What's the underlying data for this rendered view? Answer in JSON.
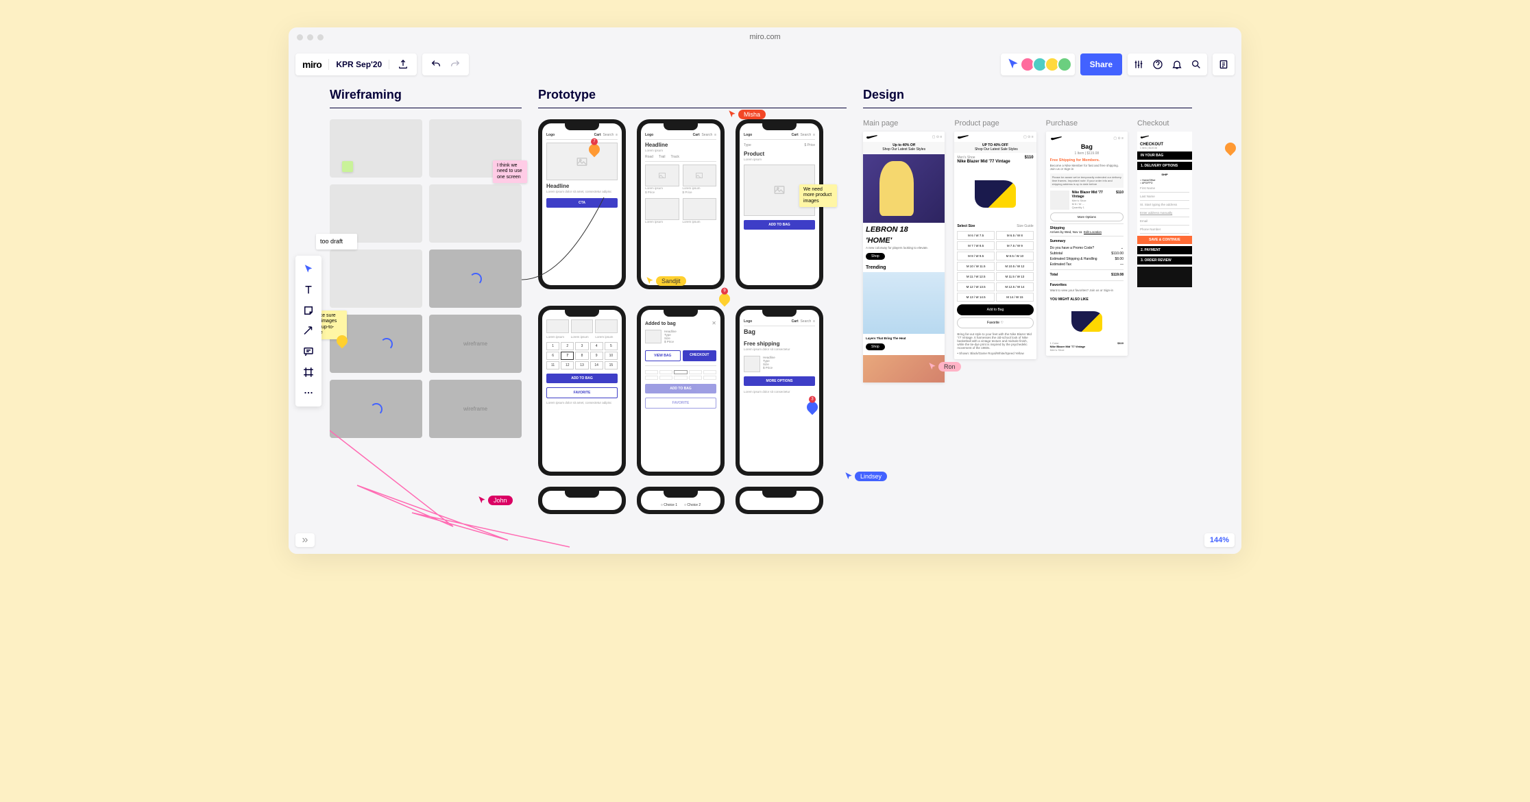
{
  "browser": {
    "url": "miro.com"
  },
  "header": {
    "logo": "miro",
    "board_name": "KPR Sep'20",
    "share_label": "Share"
  },
  "toolbar": [
    "select",
    "text",
    "sticky",
    "shape",
    "connect",
    "comment",
    "frame",
    "more"
  ],
  "sections": {
    "wireframing": {
      "title": "Wireframing"
    },
    "prototype": {
      "title": "Prototype"
    },
    "design": {
      "title": "Design",
      "columns": [
        "Main page",
        "Product page",
        "Purchase",
        "Checkout"
      ]
    }
  },
  "cursors": {
    "misha": "Misha",
    "sandjit": "Sandjit",
    "john": "John",
    "lindsey": "Lindsey",
    "ron": "Ron"
  },
  "stickies": {
    "too_draft": "too draft",
    "pink": "I think we need to use one screen",
    "need_images": "We need more product images",
    "uptodate": "Make sure the images are up-to-date"
  },
  "wireframes": {
    "placeholder_label": "wireframe"
  },
  "phones": {
    "row1": {
      "p1": {
        "logo": "Logo",
        "cart": "Cart",
        "search": "Search",
        "headline": "Headline",
        "lorem": "Lorem ipsum dolor sit amet, consectetur adipisc",
        "cta": "CTA",
        "badge": "7"
      },
      "p2": {
        "logo": "Logo",
        "cart": "Cart",
        "search": "Search",
        "headline": "Headline",
        "lorem": "Lorem ipsum",
        "tabs": [
          "Road",
          "Trail",
          "Track"
        ],
        "item_lorem": "Lorem ipsum",
        "item_price": "$ Price"
      },
      "p3": {
        "logo": "Logo",
        "cart": "Cart",
        "search": "Search",
        "type": "Type",
        "price": "$ Price",
        "product": "Product",
        "lorem": "Lorem ipsum",
        "add": "ADD TO BAG"
      }
    },
    "row2": {
      "p1": {
        "lorem": "Lorem ipsum",
        "add": "ADD TO BAG",
        "fav": "FAVORITE",
        "thumbs": 3,
        "sizes": 15
      },
      "p2": {
        "title": "Added to bag",
        "headline": "Headline",
        "type": "Type",
        "size": "Size",
        "price": "$ Price",
        "view": "VIEW BAG",
        "checkout": "CHECKOUT",
        "add": "ADD TO BAG",
        "fav": "FAVORITE",
        "badge": "9"
      },
      "p3": {
        "logo": "Logo",
        "cart": "Cart",
        "search": "Search",
        "bag": "Bag",
        "free": "Free shipping",
        "lorem": "Lorem ipsum dolor sit consectetur",
        "more": "MORE OPTIONS",
        "headline": "Headline",
        "type": "Type",
        "size": "Size",
        "price": "$ Price",
        "badge": "3"
      }
    },
    "row3": {
      "p2": {
        "choice1": "Choice 1",
        "choice2": "Choice 2"
      }
    }
  },
  "design_mockups": {
    "main": {
      "promo_top": "Up to 40% Off",
      "promo_sub": "Shop Our Latest Sale Styles",
      "lebron1": "LEBRON 18",
      "lebron2": "'HOME'",
      "desc": "A new colorway for players looking to elevate.",
      "shop": "Shop",
      "trending": "Trending",
      "layers": "Layers That Bring The Heat"
    },
    "product": {
      "promo_top": "UP TO 40% OFF",
      "promo_sub": "Shop Our Latest Sale Styles",
      "cat": "Men's Shoe",
      "title": "Nike Blazer Mid '77 Vintage",
      "price": "$110",
      "select": "Select Size",
      "guide": "Size Guide",
      "sizes": [
        "M 6 / W 7.5",
        "M 6.5 / W 8",
        "M 7 / W 8.5",
        "M 7.5 / W 9",
        "M 8 / W 9.5",
        "M 8.5 / W 10",
        "M 10 / W 11.5",
        "M 10.5 / W 12",
        "M 11 / W 12.5",
        "M 11.5 / W 13",
        "M 12 / W 13.5",
        "M 12.5 / W 14",
        "M 13 / W 14.5",
        "M 14 / W 15"
      ],
      "add": "Add to Bag",
      "fav": "Favorite ♡",
      "blurb": "Bring far-out style to your feet with the Nike Blazer Mid '77 Vintage. It harnesses the old-school look of Nike basketball with a vintage texture and midsole finish, while the tie-dye print is inspired by the psychedelic movement of the 1960s.",
      "shown": "Shown: Black/Game Royal/White/Speed Yellow"
    },
    "purchase": {
      "bag": "Bag",
      "items": "1 Item | $119.08",
      "free": "Free Shipping for Members.",
      "free_sub": "Become a Nike Member for fast and free shipping. Join us or Sign-in",
      "notice": "Please be aware we've temporarily extended our delivery time frames. Important note: If your order info and shipping address is up to date before",
      "item_title": "Nike Blazer Mid '77 Vintage",
      "item_cat": "Men's Shoe",
      "item_size": "M 8 / W ...",
      "qty": "Quantity 1",
      "item_price": "$110",
      "more_opts": "More Options",
      "ship_h": "Shipping",
      "ship_arr": "Arrives by Wed, Nov 11",
      "ship_edit": "Edit Location",
      "summary": "Summary",
      "promo": "Do you have a Promo Code?",
      "subtotal": "Subtotal",
      "subtotal_v": "$110.00",
      "shipping": "Estimated Shipping & Handling",
      "shipping_v": "$8.00",
      "tax": "Estimated Tax",
      "tax_v": "—",
      "total": "Total",
      "total_v": "$119.08",
      "favs": "Favorites",
      "favs_sub": "Want to view your favorites? Join us or Sign-in",
      "also": "YOU MIGHT ALSO LIKE",
      "rec_title": "Nike Blazer Mid '77 Vintage",
      "rec_cat": "Men's Shoe",
      "rec_price": "$110",
      "rec_color": "1 Color"
    },
    "checkout": {
      "title": "CHECKOUT",
      "items_sub": "1 Item | $119.08",
      "bag_h": "IN YOUR BAG",
      "b1": "1. DELIVERY OPTIONS",
      "b2": "2. PAYMENT",
      "b3": "3. ORDER REVIEW",
      "ship": "SHIP",
      "home": "Home/Office",
      "apo": "APO/FPO",
      "save": "SAVE & CONTINUE",
      "fields": [
        "First Name",
        "Last Name",
        "St. Start typing the address",
        "Enter address manually",
        "Email",
        "Phone Number"
      ]
    }
  },
  "zoom": "144%"
}
